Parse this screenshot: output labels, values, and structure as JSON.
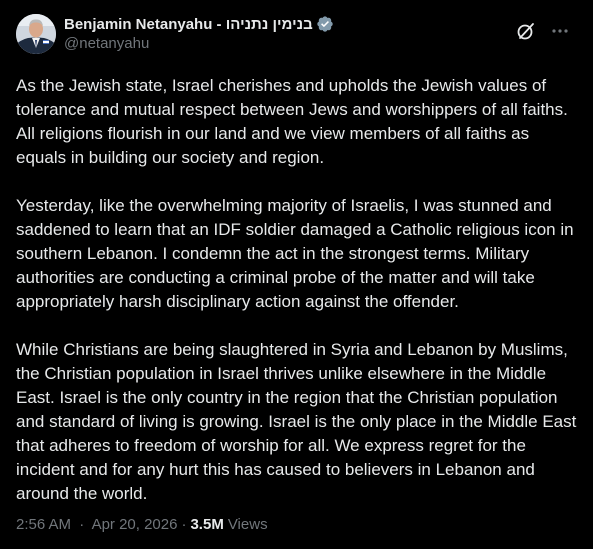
{
  "author": {
    "display_name": "Benjamin Netanyahu - בנימין נתניהו",
    "handle": "@netanyahu",
    "verified_icon": "verified-badge-icon",
    "verified_color": "#829aab"
  },
  "header_actions": {
    "grok_icon": "grok-slash-icon",
    "more_icon": "more-options-icon"
  },
  "post": {
    "paragraphs": [
      "As the Jewish state, Israel cherishes and upholds the Jewish values of tolerance and mutual respect between Jews and worshippers of all faiths. All religions flourish in our land and we view members of all faiths as equals in building our society and region.",
      "Yesterday, like the overwhelming majority of Israelis, I was stunned and saddened to learn that an IDF soldier damaged a Catholic religious icon in southern Lebanon. I condemn the act in the strongest terms. Military authorities are conducting a criminal probe of the matter and will take appropriately harsh disciplinary action against the offender.",
      "While Christians are being slaughtered in Syria and Lebanon by Muslims, the Christian population in Israel thrives unlike elsewhere in the Middle East. Israel is the only country in the region that the Christian population and standard of living is growing. Israel is the only place in the Middle East that adheres to freedom of worship for all. We express regret for the incident and for any hurt this has caused to believers in Lebanon and around the world."
    ]
  },
  "meta": {
    "time": "2:56 AM",
    "separator": "·",
    "date": "Apr 20, 2026",
    "views_count": "3.5M",
    "views_label": "Views"
  },
  "colors": {
    "background": "#000000",
    "text_primary": "#e7e9ea",
    "text_secondary": "#71767b"
  }
}
